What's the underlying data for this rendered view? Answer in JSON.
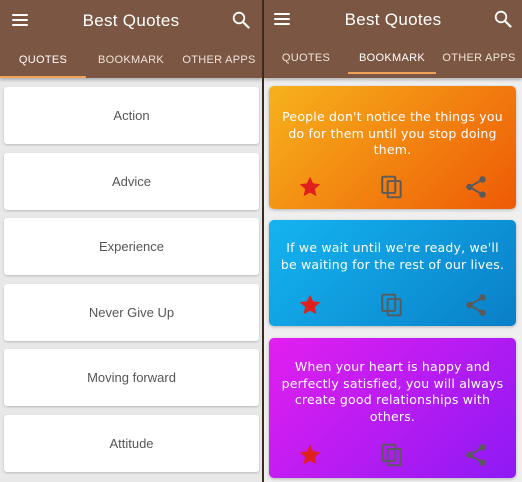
{
  "left_screen": {
    "header": {
      "title": "Best Quotes"
    },
    "tabs": [
      {
        "label": "QUOTES"
      },
      {
        "label": "BOOKMARK"
      },
      {
        "label": "OTHER APPS"
      }
    ],
    "active_tab": "QUOTES",
    "categories": [
      {
        "label": "Action"
      },
      {
        "label": "Advice"
      },
      {
        "label": "Experience"
      },
      {
        "label": "Never Give Up"
      },
      {
        "label": "Moving forward"
      },
      {
        "label": "Attitude"
      }
    ]
  },
  "right_screen": {
    "header": {
      "title": "Best Quotes"
    },
    "tabs": [
      {
        "label": "QUOTES"
      },
      {
        "label": "BOOKMARK"
      },
      {
        "label": "OTHER APPS"
      }
    ],
    "active_tab": "BOOKMARK",
    "quotes": [
      {
        "text": "People don't notice the things you do for them until you stop doing them.",
        "gradient_from": "#f7b21c",
        "gradient_to": "#ee5a06"
      },
      {
        "text": "If we wait until we're ready, we'll be waiting for the rest of our lives.",
        "gradient_from": "#14b4f0",
        "gradient_to": "#0a7fc8"
      },
      {
        "text": "When your heart is happy and perfectly satisfied, you will always create good relationships with others.",
        "gradient_from": "#e21ff0",
        "gradient_to": "#8e19f4"
      }
    ]
  },
  "colors": {
    "app_bar": "#7b5743",
    "tab_indicator": "#f0a15a",
    "bookmark_star": "#e0201c",
    "action_icon": "#5a5a5a"
  },
  "icons": {
    "menu": "menu-icon",
    "search": "search-icon",
    "bookmark": "star-icon",
    "copy": "copy-icon",
    "share": "share-icon"
  }
}
